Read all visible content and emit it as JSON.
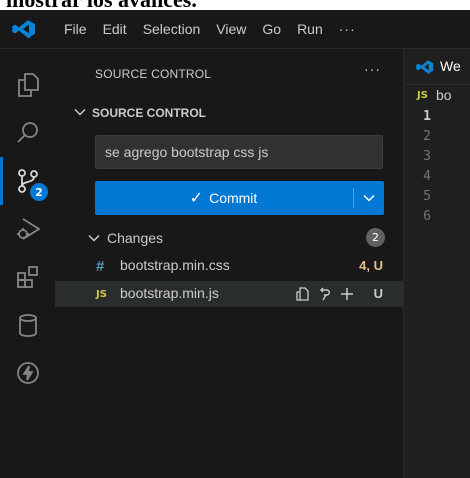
{
  "document_text": "mostrar los avances.",
  "menu": [
    "File",
    "Edit",
    "Selection",
    "View",
    "Go",
    "Run",
    "···"
  ],
  "activity_bar": {
    "items": [
      "explorer-icon",
      "search-icon",
      "source-control-icon",
      "run-debug-icon",
      "extensions-icon",
      "database-icon",
      "lightning-icon"
    ],
    "scm_badge": "2"
  },
  "sidebar": {
    "title": "SOURCE CONTROL",
    "more": "···",
    "section_title": "SOURCE CONTROL",
    "commit_message": "se agrego bootstrap css js",
    "commit_label": "Commit",
    "changes_label": "Changes",
    "changes_count": "2",
    "files": [
      {
        "icon": "#",
        "name": "bootstrap.min.css",
        "status": "4, U"
      },
      {
        "icon": "JS",
        "name": "bootstrap.min.js",
        "status": "U"
      }
    ]
  },
  "editor": {
    "tab_label": "We",
    "breadcrumb_icon": "JS",
    "breadcrumb_text": "bo",
    "line_numbers": [
      "1",
      "2",
      "3",
      "4",
      "5",
      "6"
    ]
  },
  "colors": {
    "accent": "#0078d4",
    "modified": "#e2c08d",
    "js_yellow": "#cbcb41",
    "css_blue": "#519aba"
  }
}
